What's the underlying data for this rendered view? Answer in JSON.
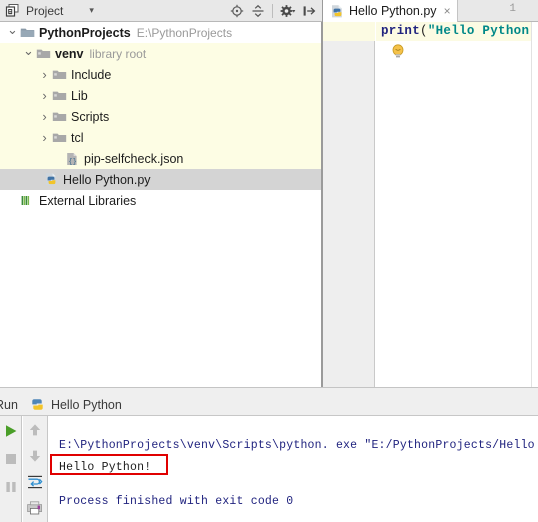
{
  "window": {
    "app": "PyCharm",
    "accent_green": "#4a9e28",
    "accent_red": "#e00000",
    "string_color": "#008888",
    "keyword_color": "#20237f"
  },
  "project_panel": {
    "icon": "project-window-icon",
    "title": "Project",
    "dropdown_caret": "▾",
    "toolbar_buttons": [
      {
        "name": "locate-icon",
        "tooltip": "Select Opened File"
      },
      {
        "name": "collapse-all-icon",
        "tooltip": "Collapse All"
      },
      {
        "name": "settings-gear-icon",
        "tooltip": "Settings"
      },
      {
        "name": "hide-panel-icon",
        "tooltip": "Hide"
      }
    ],
    "tree": [
      {
        "indent": 0,
        "arrow": "open",
        "icon": "folder-project-icon",
        "label": "PythonProjects",
        "bold": true,
        "sub": "E:\\PythonProjects",
        "state": "normal"
      },
      {
        "indent": 1,
        "arrow": "open",
        "icon": "folder-lib-icon",
        "label": "venv",
        "bold": false,
        "sub": "library root",
        "state": "scope"
      },
      {
        "indent": 2,
        "arrow": "closed",
        "icon": "folder-lib-icon",
        "label": "Include",
        "bold": false,
        "sub": "",
        "state": "scope"
      },
      {
        "indent": 2,
        "arrow": "closed",
        "icon": "folder-lib-icon",
        "label": "Lib",
        "bold": false,
        "sub": "",
        "state": "scope"
      },
      {
        "indent": 2,
        "arrow": "closed",
        "icon": "folder-lib-icon",
        "label": "Scripts",
        "bold": false,
        "sub": "",
        "state": "scope"
      },
      {
        "indent": 2,
        "arrow": "closed",
        "icon": "folder-lib-icon",
        "label": "tcl",
        "bold": false,
        "sub": "",
        "state": "scope"
      },
      {
        "indent": 2,
        "arrow": "none",
        "icon": "json-file-icon",
        "label": "pip-selfcheck.json",
        "bold": false,
        "sub": "",
        "state": "scope"
      },
      {
        "indent": 1,
        "arrow": "none",
        "icon": "python-file-icon",
        "label": "Hello Python.py",
        "bold": false,
        "sub": "",
        "state": "selected"
      },
      {
        "indent": 0,
        "arrow": "none",
        "icon": "external-libraries-icon",
        "label": "External Libraries",
        "bold": false,
        "sub": "",
        "state": "normal"
      }
    ]
  },
  "editor": {
    "tab": {
      "icon": "python-file-icon",
      "label": "Hello Python.py",
      "close": "×"
    },
    "line_number": "1",
    "code": {
      "func": "print",
      "open_paren": "(",
      "string": "\"Hello Python!\"",
      "close_paren": ")"
    },
    "intention_icon": "lightbulb-icon"
  },
  "run_panel": {
    "label": "Run",
    "tab_icon": "python-file-icon",
    "tab_label": "Hello Python",
    "toolbar_left": [
      {
        "name": "rerun-icon",
        "tooltip": "Rerun"
      },
      {
        "name": "stop-icon",
        "tooltip": "Stop"
      },
      {
        "name": "pause-icon",
        "tooltip": "Pause Output"
      }
    ],
    "toolbar_right": [
      {
        "name": "up-arrow-icon",
        "tooltip": "Up the Stack Trace"
      },
      {
        "name": "down-arrow-icon",
        "tooltip": "Down the Stack Trace"
      },
      {
        "name": "soft-wrap-icon",
        "tooltip": "Use Soft Wraps"
      },
      {
        "name": "print-icon",
        "tooltip": "Print"
      }
    ],
    "console": {
      "command": "E:\\PythonProjects\\venv\\Scripts\\python. exe \"E:/PythonProjects/Hello Python. py\"",
      "output": "Hello Python!",
      "output_highlighted": true,
      "finish": "Process finished with exit code 0"
    }
  }
}
